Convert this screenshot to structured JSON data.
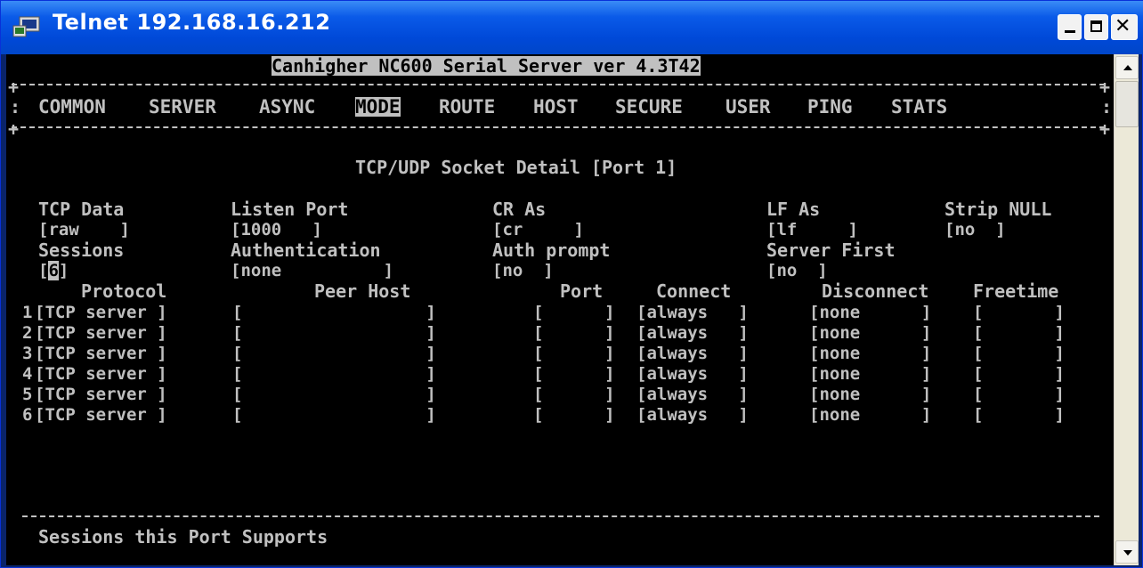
{
  "window": {
    "title": "Telnet 192.168.16.212",
    "buttons": {
      "minimize": "minimize",
      "maximize": "maximize",
      "close": "close"
    }
  },
  "terminal": {
    "header": "Canhigher NC600 Serial Server ver 4.3T42",
    "menu": [
      {
        "label": "COMMON"
      },
      {
        "label": "SERVER"
      },
      {
        "label": "ASYNC"
      },
      {
        "label": "MODE",
        "selected": true
      },
      {
        "label": "ROUTE"
      },
      {
        "label": "HOST"
      },
      {
        "label": "SECURE"
      },
      {
        "label": "USER"
      },
      {
        "label": "PING"
      },
      {
        "label": "STATS"
      }
    ],
    "section_title": "TCP/UDP Socket Detail [Port 1]",
    "fields": {
      "tcp_data": {
        "label": "TCP Data",
        "value": "[raw    ]"
      },
      "listen_port": {
        "label": "Listen Port",
        "value": "[1000   ]"
      },
      "cr_as": {
        "label": "CR As",
        "value": "[cr     ]"
      },
      "lf_as": {
        "label": "LF As",
        "value": "[lf     ]"
      },
      "strip_null": {
        "label": "Strip NULL",
        "value": "[no  ]"
      },
      "sessions": {
        "label": "Sessions",
        "bracket_open": "[",
        "value": "6",
        "bracket_close": "]"
      },
      "authentication": {
        "label": "Authentication",
        "value": "[none          ]"
      },
      "auth_prompt": {
        "label": "Auth prompt",
        "value": "[no  ]"
      },
      "server_first": {
        "label": "Server First",
        "value": "[no  ]"
      }
    },
    "table": {
      "headers": [
        "Protocol",
        "Peer Host",
        "Port",
        "Connect",
        "Disconnect",
        "Freetime"
      ],
      "rows": [
        {
          "num": "1",
          "protocol": "[TCP server ]",
          "peer": "[                  ]",
          "port": "[      ]",
          "connect": "[always   ]",
          "disconnect": "[none      ]",
          "freetime": "[       ]"
        },
        {
          "num": "2",
          "protocol": "[TCP server ]",
          "peer": "[                  ]",
          "port": "[      ]",
          "connect": "[always   ]",
          "disconnect": "[none      ]",
          "freetime": "[       ]"
        },
        {
          "num": "3",
          "protocol": "[TCP server ]",
          "peer": "[                  ]",
          "port": "[      ]",
          "connect": "[always   ]",
          "disconnect": "[none      ]",
          "freetime": "[       ]"
        },
        {
          "num": "4",
          "protocol": "[TCP server ]",
          "peer": "[                  ]",
          "port": "[      ]",
          "connect": "[always   ]",
          "disconnect": "[none      ]",
          "freetime": "[       ]"
        },
        {
          "num": "5",
          "protocol": "[TCP server ]",
          "peer": "[                  ]",
          "port": "[      ]",
          "connect": "[always   ]",
          "disconnect": "[none      ]",
          "freetime": "[       ]"
        },
        {
          "num": "6",
          "protocol": "[TCP server ]",
          "peer": "[                  ]",
          "port": "[      ]",
          "connect": "[always   ]",
          "disconnect": "[none      ]",
          "freetime": "[       ]"
        }
      ]
    },
    "status_help": "Sessions this Port Supports"
  },
  "colors": {
    "titlebar": "#0054e3",
    "terminal_bg": "#000000",
    "terminal_fg": "#c0c0c0"
  }
}
